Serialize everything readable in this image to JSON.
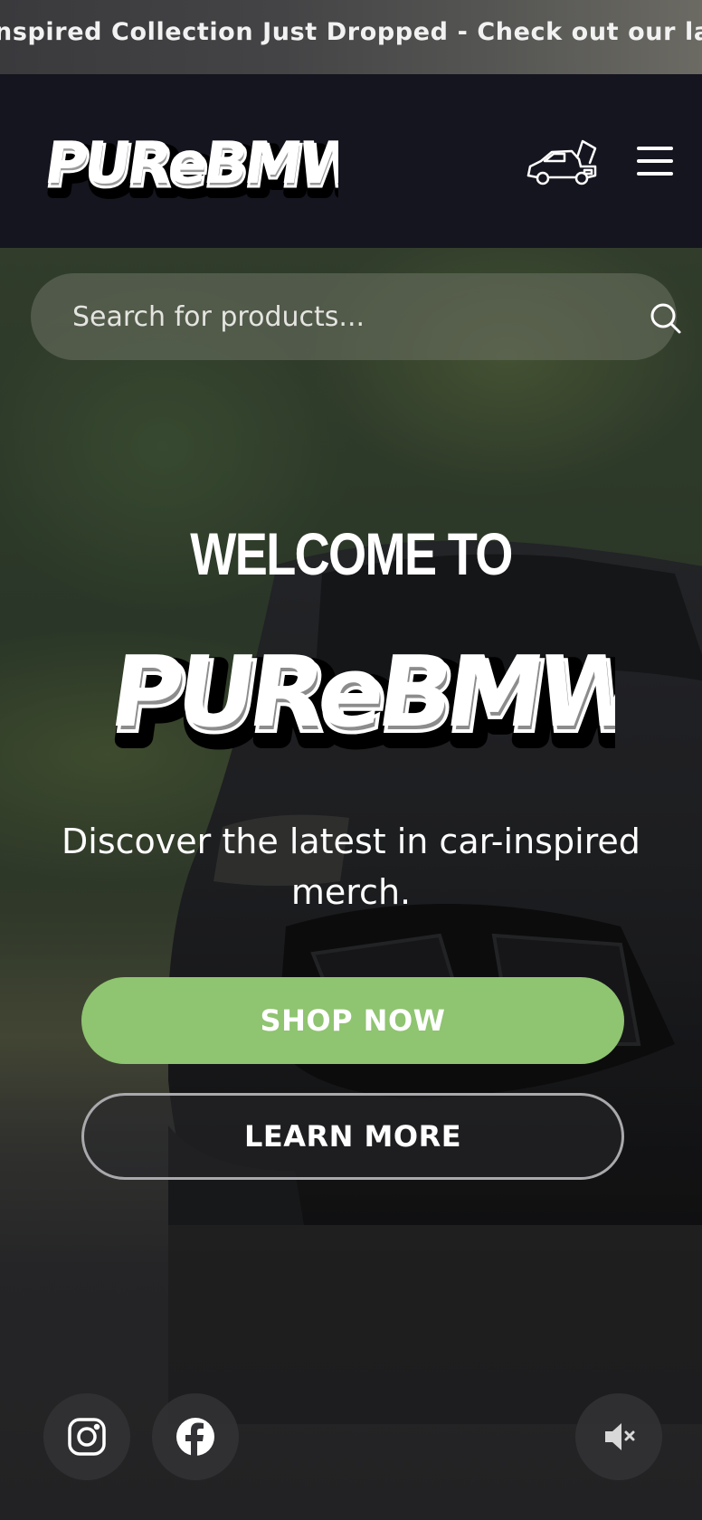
{
  "announcement": {
    "text": "nspired Collection Just Dropped - Check out our lates"
  },
  "header": {
    "logo_alt": "PURE BMWM",
    "cart_icon": "car-trunk-icon",
    "menu_icon": "hamburger-menu-icon"
  },
  "search": {
    "placeholder": "Search for products...",
    "icon": "search-icon"
  },
  "hero": {
    "welcome": "WELCOME TO",
    "logo_alt": "PURE BMWM",
    "tagline": "Discover the latest in car-inspired merch.",
    "shop_button": "SHOP NOW",
    "learn_button": "LEARN MORE"
  },
  "social": {
    "instagram_icon": "instagram-icon",
    "facebook_icon": "facebook-icon",
    "mute_icon": "speaker-muted-icon"
  },
  "colors": {
    "accent_green": "#8fc470",
    "header_bg": "#15151f"
  }
}
